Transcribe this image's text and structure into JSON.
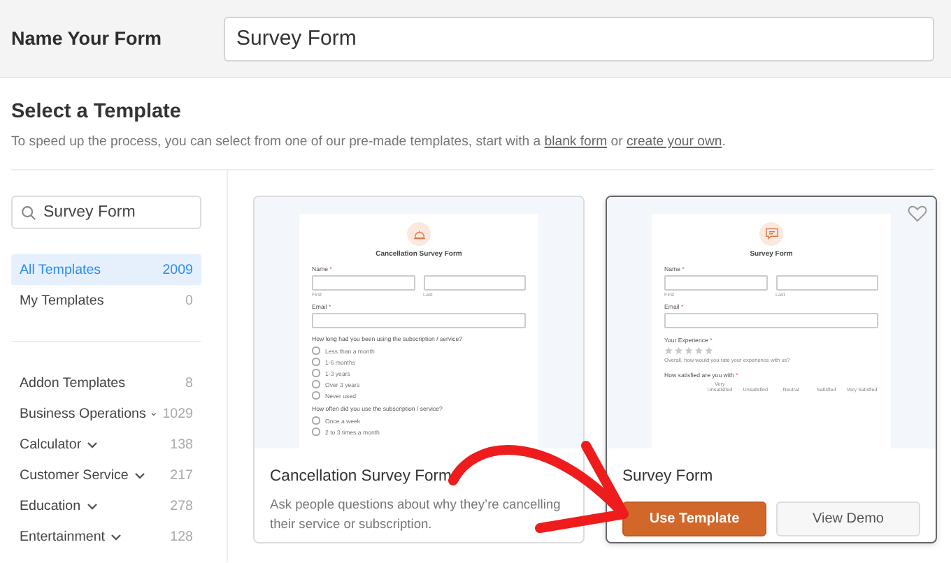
{
  "form_name": {
    "label": "Name Your Form",
    "value": "Survey Form"
  },
  "section": {
    "title": "Select a Template",
    "description": {
      "before": "To speed up the process, you can select from one of our pre-made templates, start with a ",
      "link_1": "blank form",
      "between": " or ",
      "link_2": "create your own",
      "after": "."
    }
  },
  "sidebar": {
    "search": {
      "value": "Survey Form"
    },
    "primary_items": [
      {
        "label": "All Templates",
        "count": "2009",
        "selected": true
      },
      {
        "label": "My Templates",
        "count": "0",
        "selected": false
      }
    ],
    "category_items": [
      {
        "label": "Addon Templates",
        "count": "8",
        "expandable": false,
        "selected": false
      },
      {
        "label": "Business Operations",
        "count": "1029",
        "expandable": true,
        "selected": false
      },
      {
        "label": "Calculator",
        "count": "138",
        "expandable": true,
        "selected": false
      },
      {
        "label": "Customer Service",
        "count": "217",
        "expandable": true,
        "selected": false
      },
      {
        "label": "Education",
        "count": "278",
        "expandable": true,
        "selected": false
      },
      {
        "label": "Entertainment",
        "count": "128",
        "expandable": true,
        "selected": false
      }
    ]
  },
  "templates": [
    {
      "title": "Cancellation Survey Form",
      "selected": false,
      "description": "Ask people questions about why they’re cancelling their service or subscription.",
      "preview": {
        "title": "Cancellation Survey Form",
        "fields": [
          {
            "kind": "name",
            "label": "Name",
            "mark": "*",
            "sublabels": [
              "First",
              "Last"
            ]
          },
          {
            "kind": "email",
            "label": "Email",
            "mark": "*"
          },
          {
            "kind": "choice",
            "label": "How long had you been using the subscription / service?",
            "options": [
              {
                "label": "Less than a month",
                "selected": false
              },
              {
                "label": "1-6 months",
                "selected": false
              },
              {
                "label": "1-3 years",
                "selected": false
              },
              {
                "label": "Over 3 years",
                "selected": false
              },
              {
                "label": "Never used",
                "selected": false
              }
            ]
          },
          {
            "kind": "choice",
            "label": "How often did you use the subscription / service?",
            "options": [
              {
                "label": "Once a week",
                "selected": false
              },
              {
                "label": "2 to 3 times a month",
                "selected": false
              }
            ]
          }
        ]
      }
    },
    {
      "title": "Survey Form",
      "selected": true,
      "buttons": [
        {
          "label": "Use Template",
          "kind": "primary"
        },
        {
          "label": "View Demo",
          "kind": "secondary"
        }
      ],
      "preview": {
        "title": "Survey Form",
        "fields": [
          {
            "kind": "name",
            "label": "Name",
            "mark": "*",
            "sublabels": [
              "First",
              "Last"
            ]
          },
          {
            "kind": "email",
            "label": "Email",
            "mark": "*"
          },
          {
            "kind": "rating",
            "label": "Your Experience",
            "mark": "*",
            "stars": 0,
            "hint": "Overall, how would you rate your experience with us?"
          },
          {
            "kind": "matrix",
            "label": "How satisfied are you with",
            "mark": "*",
            "columns": [
              "Very Unsatisfied",
              "Unsatisfied",
              "Neutral",
              "Satisfied",
              "Very Satisfied"
            ]
          }
        ]
      }
    }
  ]
}
